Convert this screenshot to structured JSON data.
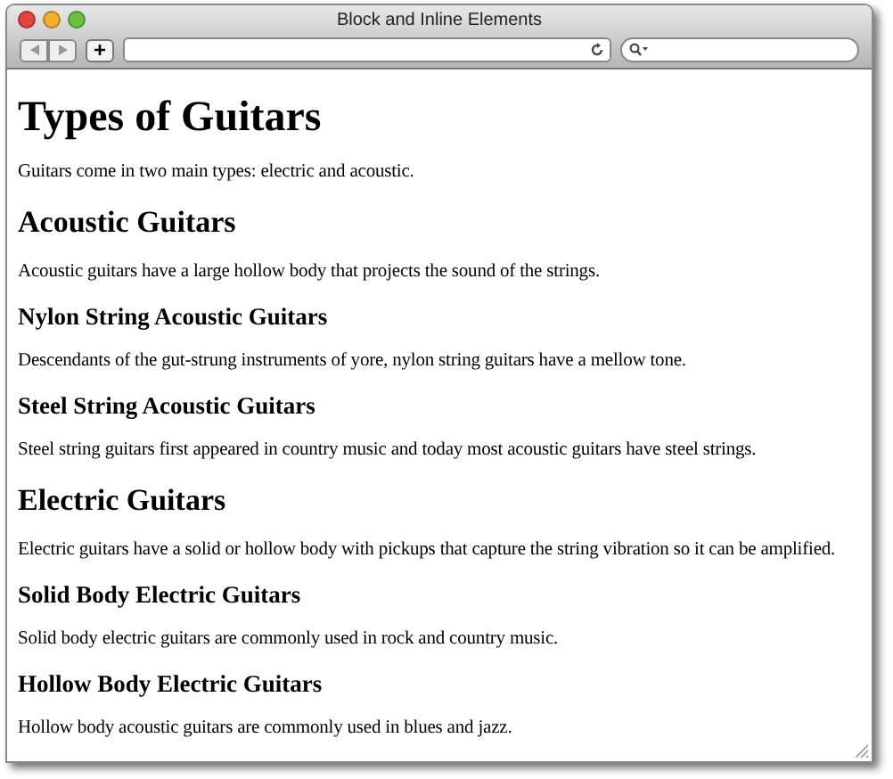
{
  "window": {
    "title": "Block and Inline Elements"
  },
  "toolbar": {
    "new_tab": "+"
  },
  "content": [
    {
      "kind": "h1",
      "text": "Types of Guitars"
    },
    {
      "kind": "p",
      "text": "Guitars come in two main types: electric and acoustic."
    },
    {
      "kind": "h2",
      "text": "Acoustic Guitars"
    },
    {
      "kind": "p",
      "text": "Acoustic guitars have a large hollow body that projects the sound of the strings."
    },
    {
      "kind": "h3",
      "text": "Nylon String Acoustic Guitars"
    },
    {
      "kind": "p",
      "text": "Descendants of the gut-strung instruments of yore, nylon string guitars have a mellow tone."
    },
    {
      "kind": "h3",
      "text": "Steel String Acoustic Guitars"
    },
    {
      "kind": "p",
      "text": "Steel string guitars first appeared in country music and today most acoustic guitars have steel strings."
    },
    {
      "kind": "h2",
      "text": "Electric Guitars"
    },
    {
      "kind": "p",
      "text": "Electric guitars have a solid or hollow body with pickups that capture the string vibration so it can be amplified."
    },
    {
      "kind": "h3",
      "text": "Solid Body Electric Guitars"
    },
    {
      "kind": "p",
      "text": "Solid body electric guitars are commonly used in rock and country music."
    },
    {
      "kind": "h3",
      "text": "Hollow Body Electric Guitars"
    },
    {
      "kind": "p",
      "text": "Hollow body acoustic guitars are commonly used in blues and jazz."
    }
  ]
}
